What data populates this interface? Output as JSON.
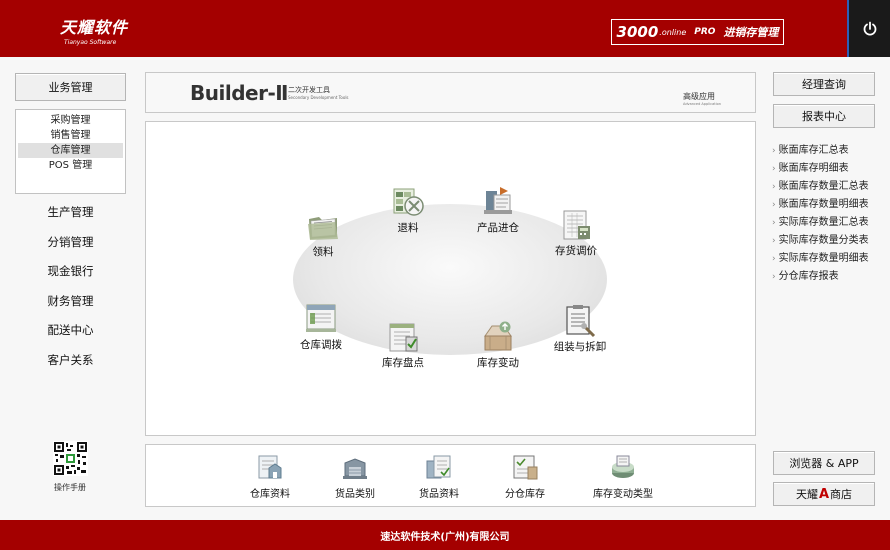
{
  "header": {
    "logo_main": "天耀软件",
    "logo_sub": "Tianyao Software",
    "product_num": "3000",
    "product_online": ".online",
    "product_pro": "PRO",
    "product_title": "进销存管理",
    "brand_color": "#a40000"
  },
  "sidebar": {
    "section_title": "业务管理",
    "sub_items": [
      "采购管理",
      "销售管理",
      "仓库管理",
      "POS 管理"
    ],
    "active_sub": "仓库管理",
    "items": [
      "生产管理",
      "分销管理",
      "现金银行",
      "财务管理",
      "配送中心",
      "客户关系"
    ],
    "manual_label": "操作手册"
  },
  "banner": {
    "title": "Builder-Ⅱ",
    "subtitle": "二次开发工具",
    "subtitle_en": "Secondary Development Tools",
    "advanced": "高级应用",
    "advanced_en": "Advanced Application"
  },
  "flow": {
    "nodes": [
      {
        "label": "领料",
        "icon": "folder-icon"
      },
      {
        "label": "退料",
        "icon": "return-material-icon"
      },
      {
        "label": "产品进仓",
        "icon": "product-inbound-icon"
      },
      {
        "label": "存货调价",
        "icon": "price-adjust-icon"
      },
      {
        "label": "仓库调拨",
        "icon": "warehouse-transfer-icon"
      },
      {
        "label": "库存盘点",
        "icon": "stocktake-icon"
      },
      {
        "label": "库存变动",
        "icon": "inventory-change-icon"
      },
      {
        "label": "组装与拆卸",
        "icon": "assembly-icon"
      }
    ]
  },
  "bottom_tools": [
    {
      "label": "仓库资料",
      "icon": "warehouse-data-icon"
    },
    {
      "label": "货品类别",
      "icon": "goods-category-icon"
    },
    {
      "label": "货品资料",
      "icon": "goods-data-icon"
    },
    {
      "label": "分仓库存",
      "icon": "branch-inventory-icon"
    },
    {
      "label": "库存变动类型",
      "icon": "change-type-icon"
    }
  ],
  "right": {
    "manager_query": "经理查询",
    "report_center": "报表中心",
    "reports": [
      "账面库存汇总表",
      "账面库存明细表",
      "账面库存数量汇总表",
      "账面库存数量明细表",
      "实际库存数量汇总表",
      "实际库存数量分类表",
      "实际库存数量明细表",
      "分仓库存报表"
    ],
    "browser_app": "浏览器 & APP",
    "store_prefix": "天耀",
    "store_letter": "A",
    "store_suffix": "商店"
  },
  "footer": {
    "company": "速达软件技术(广州)有限公司"
  }
}
